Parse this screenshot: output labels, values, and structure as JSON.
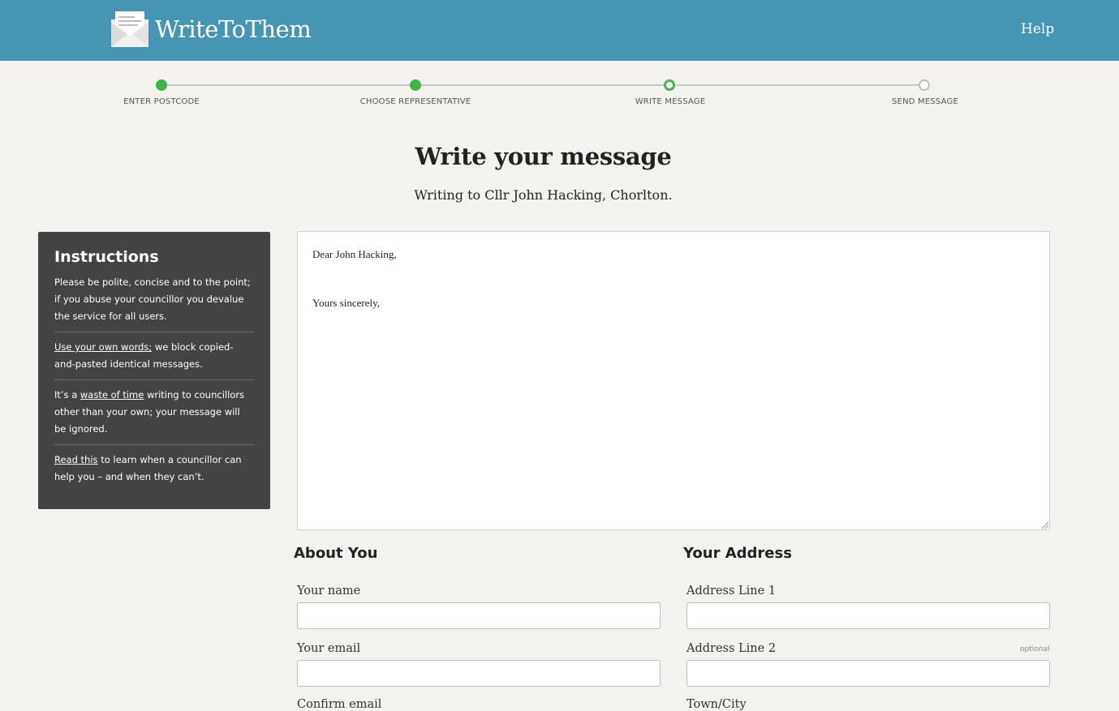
{
  "header": {
    "logo_text": "WriteToThem",
    "help_label": "Help",
    "background_color": "#4795b5"
  },
  "steps": [
    {
      "label": "ENTER POSTCODE",
      "status": "done"
    },
    {
      "label": "CHOOSE REPRESENTATIVE",
      "status": "done"
    },
    {
      "label": "WRITE MESSAGE",
      "status": "current"
    },
    {
      "label": "SEND MESSAGE",
      "status": "todo"
    }
  ],
  "page": {
    "title": "Write your message",
    "subtitle": "Writing to Cllr John Hacking, Chorlton."
  },
  "instructions": {
    "title": "Instructions",
    "item1": "Please be polite, concise and to the point; if you abuse your councillor you devalue the service for all users.",
    "item2_link": "Use your own words;",
    "item2_rest": " we block copied-and-pasted identical messages.",
    "item3_pre": "It’s a ",
    "item3_link": "waste of time",
    "item3_rest": " writing to councillors other than your own; your message will be ignored.",
    "item4_link": "Read this",
    "item4_rest": " to learn when a councillor can help you – and when they can’t."
  },
  "message": {
    "value": "Dear John Hacking,\n\n\nYours sincerely,\n"
  },
  "about_you": {
    "heading": "About You",
    "name_label": "Your name",
    "email_label": "Your email",
    "confirm_email_label": "Confirm email"
  },
  "address": {
    "heading": "Your Address",
    "line1_label": "Address Line 1",
    "line2_label": "Address Line 2",
    "line2_optional": "optional",
    "town_label": "Town/City"
  },
  "colors": {
    "accent_green": "#3eb64a",
    "panel_dark": "#434343",
    "page_background": "#f3f2ee"
  }
}
